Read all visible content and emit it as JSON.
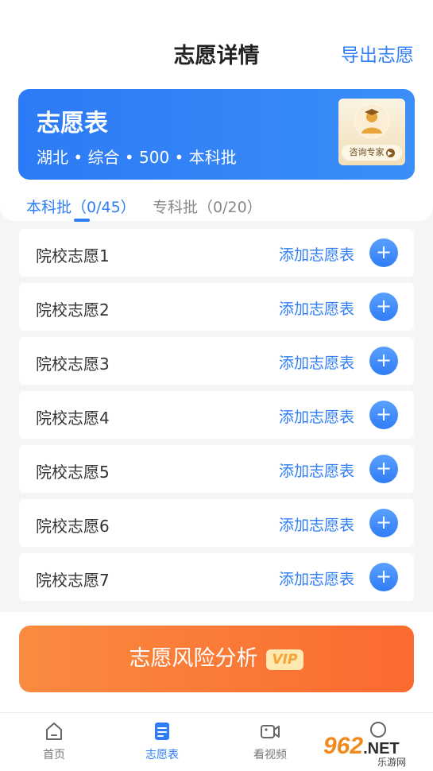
{
  "header": {
    "title": "志愿详情",
    "export_label": "导出志愿"
  },
  "banner": {
    "title": "志愿表",
    "subtitle": "湖北 • 综合 • 500 • 本科批",
    "expert_label": "咨询专家",
    "accent": "#2f7df6"
  },
  "tabs": {
    "active": "本科批（0/45）",
    "inactive": "专科批（0/20）"
  },
  "rows": [
    {
      "label": "院校志愿1",
      "action": "添加志愿表",
      "icon": "plus-icon"
    },
    {
      "label": "院校志愿2",
      "action": "添加志愿表",
      "icon": "plus-icon"
    },
    {
      "label": "院校志愿3",
      "action": "添加志愿表",
      "icon": "plus-icon"
    },
    {
      "label": "院校志愿4",
      "action": "添加志愿表",
      "icon": "plus-icon"
    },
    {
      "label": "院校志愿5",
      "action": "添加志愿表",
      "icon": "plus-icon"
    },
    {
      "label": "院校志愿6",
      "action": "添加志愿表",
      "icon": "plus-icon"
    },
    {
      "label": "院校志愿7",
      "action": "添加志愿表",
      "icon": "plus-icon"
    }
  ],
  "risk_button": {
    "label": "志愿风险分析",
    "badge": "VIP",
    "color": "#fb6a2f"
  },
  "tabbar": [
    {
      "label": "首页",
      "icon": "home-icon"
    },
    {
      "label": "志愿表",
      "icon": "document-icon",
      "active": true
    },
    {
      "label": "看视频",
      "icon": "video-camera-icon"
    }
  ],
  "watermark": {
    "main": "962",
    "suffix": ".NET",
    "sub": "乐游网"
  }
}
